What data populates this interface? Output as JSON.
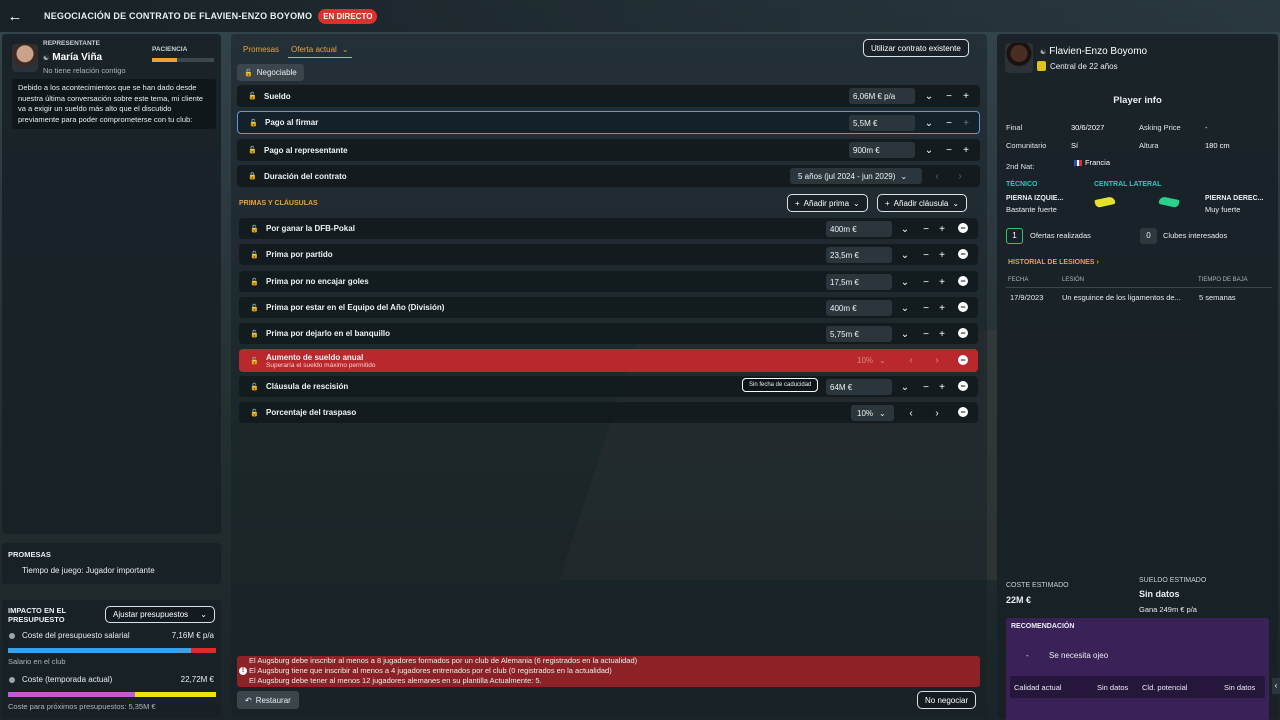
{
  "header": {
    "title": "NEGOCIACIÓN DE CONTRATO DE FLAVIEN-ENZO BOYOMO",
    "live": "EN DIRECTO"
  },
  "agent": {
    "role": "REPRESENTANTE",
    "name": "María Viña",
    "relation": "No tiene relación contigo",
    "patience_label": "PACIENCIA",
    "patience_level": 0.4,
    "message": "Debido a los acontecimientos que se han dado desde nuestra última conversación sobre este tema, mi cliente va a exigir un sueldo más alto que el discutido previamente para poder comprometerse con tu club:"
  },
  "promises": {
    "title": "PROMESAS",
    "item": "Tiempo de juego: Jugador importante"
  },
  "budget": {
    "title": "IMPACTO EN EL PRESUPUESTO",
    "adjust": "Ajustar presupuestos",
    "wage_label": "Coste del presupuesto salarial",
    "wage_value": "7,16M € p/a",
    "wage_sub": "Salario en el club",
    "cost_label": "Coste (temporada actual)",
    "cost_value": "22,72M €",
    "cost_sub": "Coste para próximos presupuestos: 5,35M €"
  },
  "tabs": {
    "promises": "Promesas",
    "offer": "Oferta actual",
    "use_existing": "Utilizar contrato existente"
  },
  "negotiable": "Negociable",
  "contract": [
    {
      "label": "Sueldo",
      "value": "6,06M € p/a"
    },
    {
      "label": "Pago al firmar",
      "value": "5,5M €"
    },
    {
      "label": "Pago al representante",
      "value": "900m €"
    },
    {
      "label": "Duración del contrato",
      "value": "5 años (jul 2024 - jun 2029)"
    }
  ],
  "bonuses_title": "PRIMAS Y CLÁUSULAS",
  "add_bonus": "Añadir prima",
  "add_clause": "Añadir cláusula",
  "bonuses": [
    {
      "label": "Por ganar la DFB-Pokal",
      "value": "400m €"
    },
    {
      "label": "Prima por partido",
      "value": "23,5m €"
    },
    {
      "label": "Prima por no encajar goles",
      "value": "17,5m €"
    },
    {
      "label": "Prima por estar en el Equipo del Año (División)",
      "value": "400m €"
    },
    {
      "label": "Prima por dejarlo en el banquillo",
      "value": "5,75m €"
    },
    {
      "label": "Aumento de sueldo anual",
      "sub": "Superaría el sueldo máximo permitido",
      "value": "10%"
    },
    {
      "label": "Cláusula de rescisión",
      "value": "64M €",
      "chip": "Sin fecha de caducidad"
    },
    {
      "label": "Porcentaje del traspaso",
      "value": "10%"
    }
  ],
  "warnings": [
    "El Augsburg debe inscribir al menos a 8 jugadores formados por un club de Alemania (6 registrados en la actualidad)",
    "El Augsburg tiene que inscribir al menos a 4 jugadores entrenados por el club (0 registrados en la actualidad)",
    "El Augsburg debe tener al menos 12 jugadores alemanes en su plantilla Actualmente: 5."
  ],
  "footer": {
    "restore": "Restaurar",
    "no_negotiate": "No negociar"
  },
  "player": {
    "name": "Flavien-Enzo Boyomo",
    "role": "Central de 22 años",
    "info_title": "Player info",
    "final_l": "Final",
    "final_v": "30/6/2027",
    "asking_l": "Asking Price",
    "asking_v": "-",
    "comm_l": "Comunitario",
    "comm_v": "Sí",
    "height_l": "Altura",
    "height_v": "180 cm",
    "nat_l": "2nd Nat:",
    "nat_v": "Francia",
    "technical": "TÉCNICO",
    "position": "CENTRAL LATERAL",
    "left_foot": "PIERNA IZQUIE...",
    "left_foot_v": "Bastante fuerte",
    "right_foot": "PIERNA DEREC...",
    "right_foot_v": "Muy fuerte",
    "offers_n": "1",
    "offers_l": "Ofertas realizadas",
    "clubs_n": "0",
    "clubs_l": "Clubes interesados",
    "injury_title": "HISTORIAL DE LESIONES",
    "inj_h": [
      "FECHA",
      "LESIÓN",
      "TIEMPO DE BAJA"
    ],
    "inj_row": [
      "17/9/2023",
      "Un esguince de los ligamentos de...",
      "5 semanas"
    ],
    "cost_l": "COSTE ESTIMADO",
    "cost_v": "22M €",
    "wage_l": "SUELDO ESTIMADO",
    "wage_v": "Sin datos",
    "wage_sub": "Gana 249m € p/a",
    "rec_title": "RECOMENDACIÓN",
    "rec_dash": "-",
    "rec_text": "Se necesita ojeo",
    "cur_l": "Calidad actual",
    "cur_v": "Sin datos",
    "pot_l": "Cld. potencial",
    "pot_v": "Sin datos"
  }
}
